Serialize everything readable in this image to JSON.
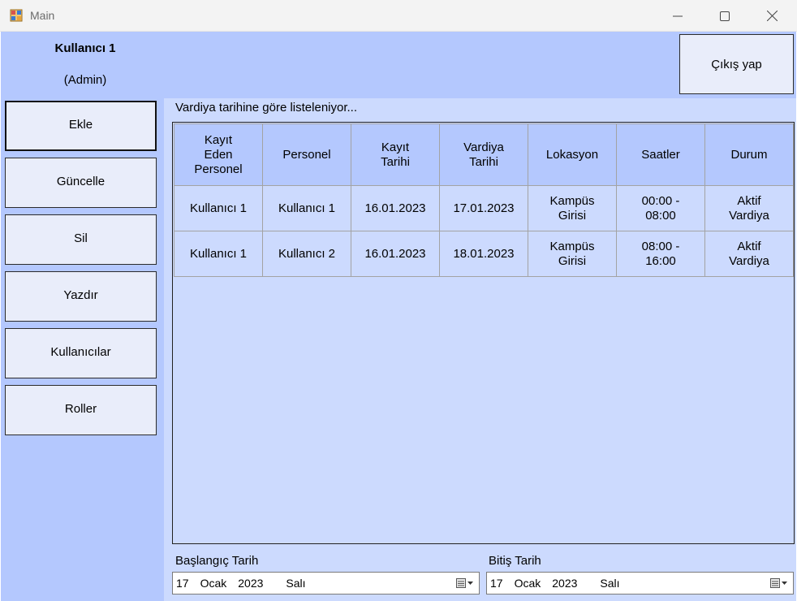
{
  "window": {
    "title": "Main"
  },
  "user": {
    "name": "Kullanıcı 1",
    "role": "(Admin)"
  },
  "buttons": {
    "logout": "Çıkış yap"
  },
  "sidebar": {
    "items": [
      {
        "label": "Ekle"
      },
      {
        "label": "Güncelle"
      },
      {
        "label": "Sil"
      },
      {
        "label": "Yazdır"
      },
      {
        "label": "Kullanıcılar"
      },
      {
        "label": "Roller"
      }
    ]
  },
  "main": {
    "caption": "Vardiya tarihine göre listeleniyor...",
    "table": {
      "columns": [
        "Kayıt Eden Personel",
        "Personel",
        "Kayıt Tarihi",
        "Vardiya Tarihi",
        "Lokasyon",
        "Saatler",
        "Durum"
      ],
      "rows": [
        [
          "Kullanıcı 1",
          "Kullanıcı 1",
          "16.01.2023",
          "17.01.2023",
          "Kampüs Girisi",
          "00:00 - 08:00",
          "Aktif Vardiya"
        ],
        [
          "Kullanıcı 1",
          "Kullanıcı 2",
          "16.01.2023",
          "18.01.2023",
          "Kampüs Girisi",
          "08:00 - 16:00",
          "Aktif Vardiya"
        ]
      ]
    }
  },
  "filters": {
    "start": {
      "label": "Başlangıç Tarih",
      "day": "17",
      "month": "Ocak",
      "year": "2023",
      "weekday": "Salı"
    },
    "end": {
      "label": "Bitiş Tarih",
      "day": "17",
      "month": "Ocak",
      "year": "2023",
      "weekday": "Salı"
    }
  },
  "colors": {
    "background": "#b4c8fe",
    "panel": "#ccdafe",
    "button": "#e9edfa"
  }
}
